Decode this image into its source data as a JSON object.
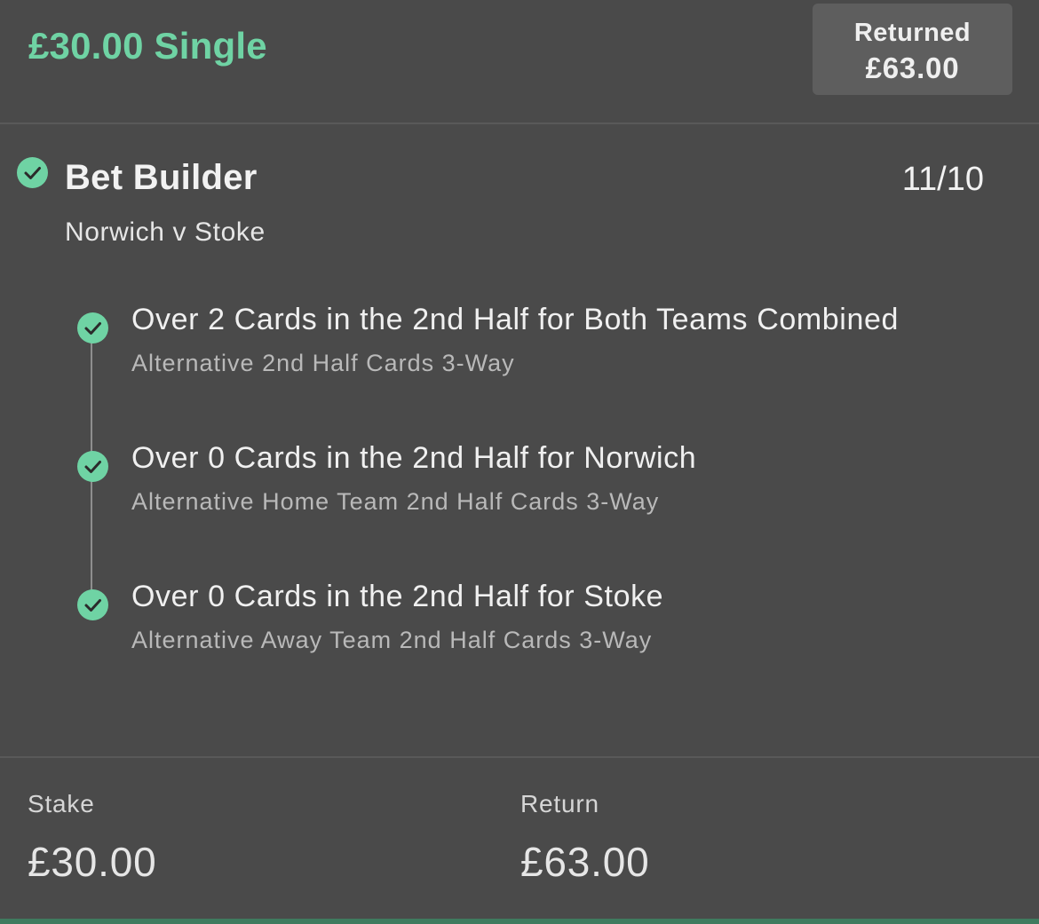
{
  "header": {
    "title": "£30.00 Single",
    "returned_label": "Returned",
    "returned_amount": "£63.00"
  },
  "selection": {
    "title": "Bet Builder",
    "odds": "11/10",
    "event": "Norwich v Stoke",
    "status_icon": "check-circle-icon",
    "legs": [
      {
        "title": "Over 2 Cards in the 2nd Half for Both Teams Combined",
        "market": "Alternative 2nd Half Cards 3-Way",
        "status_icon": "check-circle-icon"
      },
      {
        "title": "Over 0 Cards in the 2nd Half for Norwich",
        "market": "Alternative Home Team 2nd Half Cards 3-Way",
        "status_icon": "check-circle-icon"
      },
      {
        "title": "Over 0 Cards in the 2nd Half for Stoke",
        "market": "Alternative Away Team 2nd Half Cards 3-Way",
        "status_icon": "check-circle-icon"
      }
    ]
  },
  "footer": {
    "stake_label": "Stake",
    "stake_value": "£30.00",
    "return_label": "Return",
    "return_value": "£63.00"
  },
  "colors": {
    "background": "#4a4a4a",
    "accent_green": "#6fd3a4",
    "badge_background": "#5e5e5e",
    "bottom_bar": "#3f7b5f"
  }
}
